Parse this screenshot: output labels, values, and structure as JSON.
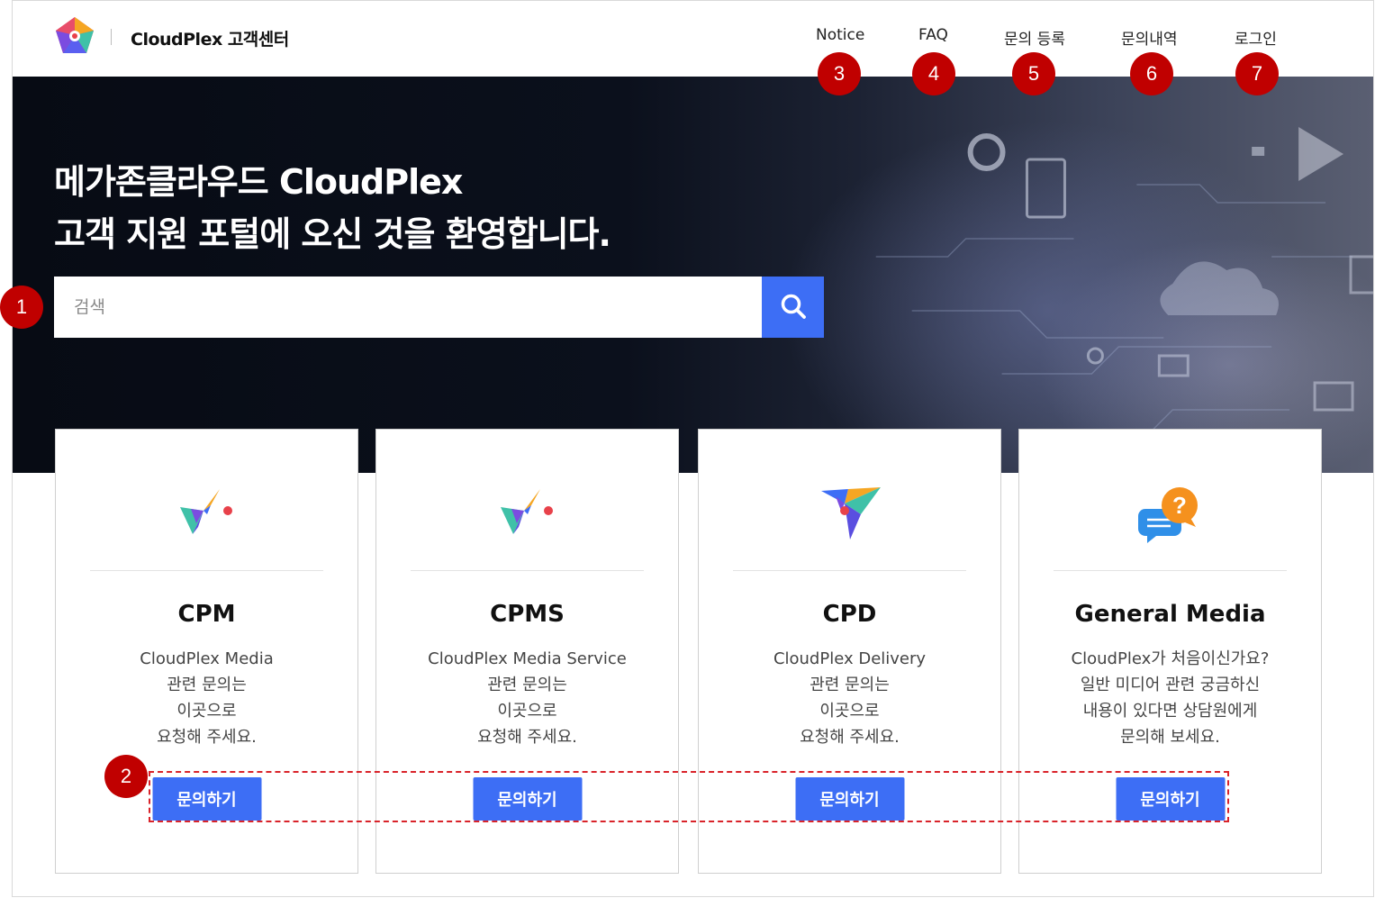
{
  "header": {
    "brand": "CloudPlex 고객센터",
    "nav": {
      "notice": "Notice",
      "faq": "FAQ",
      "register": "문의 등록",
      "history": "문의내역",
      "login": "로그인"
    }
  },
  "hero": {
    "title_line1": "메가존클라우드 CloudPlex",
    "title_line2": "고객 지원 포털에 오신 것을 환영합니다.",
    "search_placeholder": "검색"
  },
  "cards": [
    {
      "icon": "cpm-logo-icon",
      "title": "CPM",
      "desc": [
        "CloudPlex Media",
        "관련 문의는",
        "이곳으로",
        "요청해 주세요."
      ],
      "button": "문의하기"
    },
    {
      "icon": "cpms-logo-icon",
      "title": "CPMS",
      "desc": [
        "CloudPlex Media Service",
        "관련 문의는",
        "이곳으로",
        "요청해 주세요."
      ],
      "button": "문의하기"
    },
    {
      "icon": "cpd-logo-icon",
      "title": "CPD",
      "desc": [
        "CloudPlex Delivery",
        "관련 문의는",
        "이곳으로",
        "요청해 주세요."
      ],
      "button": "문의하기"
    },
    {
      "icon": "chat-question-icon",
      "title": "General Media",
      "desc": [
        "CloudPlex가 처음이신가요?",
        "일반 미디어 관련 궁금하신",
        "내용이 있다면 상담원에게",
        "문의해 보세요."
      ],
      "button": "문의하기"
    }
  ],
  "markers": [
    "1",
    "2",
    "3",
    "4",
    "5",
    "6",
    "7"
  ],
  "colors": {
    "accent": "#3d6ef5",
    "marker": "#c00000",
    "hero_bg": "#0b101c"
  }
}
